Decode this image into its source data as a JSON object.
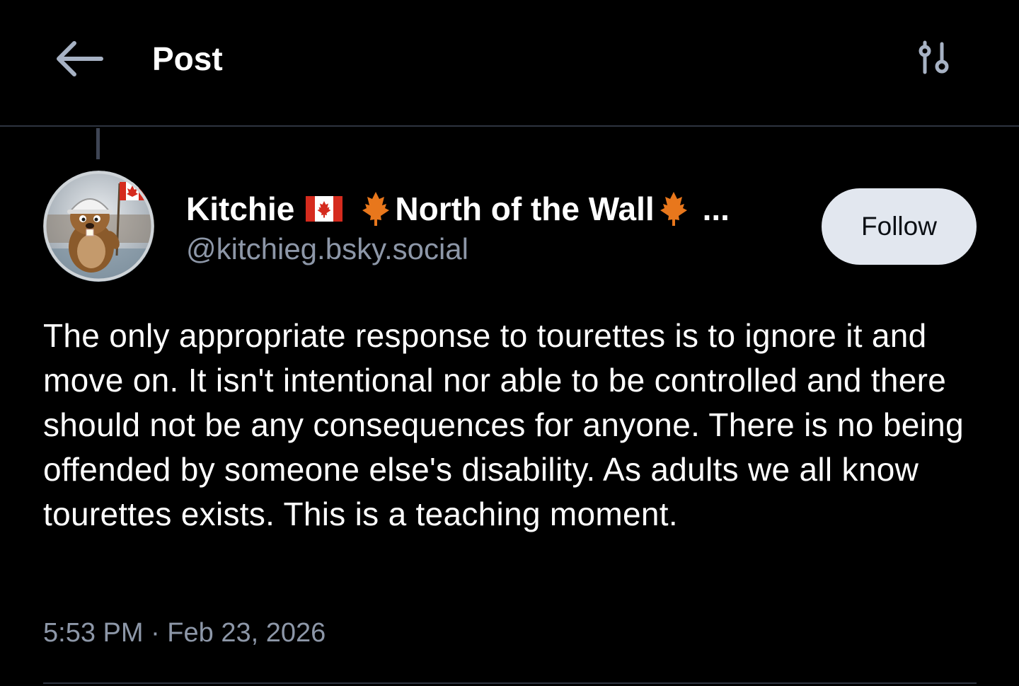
{
  "header": {
    "title": "Post",
    "back_icon": "arrow-left-icon",
    "settings_icon": "sliders-icon"
  },
  "author": {
    "name": "Kitchie",
    "name_suffix": "North of the Wall",
    "ellipsis": "...",
    "handle": "@kitchieg.bsky.social",
    "flag_icon": "canada-flag-icon",
    "leaf_icon": "maple-leaf-icon"
  },
  "follow_button": {
    "label": "Follow"
  },
  "post": {
    "text": "The only appropriate response to tourettes is to ignore it and move on. It isn't intentional nor able to be controlled and there should not be any consequences for anyone. There is no being offended by someone else's disability. As adults we all know tourettes exists. This is a teaching moment.",
    "timestamp": "5:53 PM · Feb 23, 2026"
  },
  "colors": {
    "background": "#000000",
    "divider": "#2e3440",
    "muted_text": "#8d97a8",
    "follow_bg": "#e2e7ef",
    "maple_orange": "#e8771c",
    "flag_red": "#d52b1e"
  }
}
